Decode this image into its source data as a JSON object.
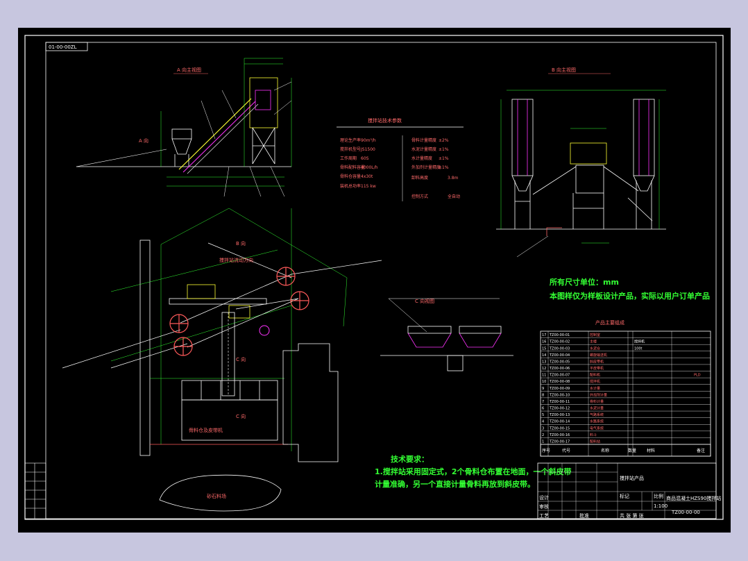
{
  "drawing": {
    "number_tag": "01-00-00ZL",
    "drawing_number": "TZ00-00-00",
    "colors": {
      "background": "#c7c6df",
      "canvas": "#000000",
      "frame": "#ffffff",
      "green": "#33ff33",
      "red": "#ff5a5a",
      "magenta": "#ff33ff",
      "yellow": "#ffff33"
    }
  },
  "views": {
    "a_view": "A 向主视图",
    "b_view": "B 向主视图",
    "c_view": "C 向视图",
    "plan_arrow": "搅拌站流动方向",
    "a_dir": "A 向",
    "b_dir": "B 向",
    "c_dir": "C 向"
  },
  "params": {
    "title": "搅拌站技术参数",
    "rows": [
      {
        "name": "理论生产率",
        "value": "90m³/h"
      },
      {
        "name": "搅拌机型号",
        "value": "JS1500"
      },
      {
        "name": "工作周期",
        "value": "60S"
      },
      {
        "name": "骨料配料容量",
        "value": "4000L/h"
      },
      {
        "name": "骨料仓容量",
        "value": "4x30t"
      },
      {
        "name": "装机总功率",
        "value": "115 kw"
      }
    ],
    "rows2": [
      {
        "name": "骨料计量精度",
        "value": "±2%"
      },
      {
        "name": "水泥计量精度",
        "value": "±1%"
      },
      {
        "name": "水计量精度",
        "value": "±1%"
      },
      {
        "name": "外加剂计量精度",
        "value": "±1%"
      },
      {
        "name": "卸料高度",
        "value": "3.8m"
      },
      {
        "name": "控制方式",
        "value": "全自动"
      }
    ]
  },
  "plan_labels": {
    "silo_area": "砂石料场",
    "storage": "骨料仓及皮带机",
    "c_label": "C 向"
  },
  "notes": {
    "unit": "所有尺寸单位：mm",
    "statement": "本图样仅为样板设计产品，实际以用户订单产品",
    "tech_title": "技术要求：",
    "tech_1": "1.搅拌站采用固定式，2个骨料仓布置在地面，一个斜皮带",
    "tech_2": "计量准确，另一个直接计量骨料再放到斜皮带。"
  },
  "parts_list": {
    "title": "产品主要组成",
    "headers": [
      "序号",
      "代号",
      "名称",
      "数量",
      "材料",
      "备注"
    ],
    "rows": [
      {
        "no": "17",
        "code": "TZ00-00-01",
        "name": "控制室"
      },
      {
        "no": "16",
        "code": "TZ00-00-02",
        "name": "主楼",
        "material": "搅拌机"
      },
      {
        "no": "15",
        "code": "TZ00-00-03",
        "name": "水泥仓",
        "material": "100t"
      },
      {
        "no": "14",
        "code": "TZ00-00-04",
        "name": "螺旋输送机"
      },
      {
        "no": "13",
        "code": "TZ00-00-05",
        "name": "斜皮带机"
      },
      {
        "no": "12",
        "code": "TZ00-00-06",
        "name": "平皮带机"
      },
      {
        "no": "11",
        "code": "TZ00-00-07",
        "name": "配料机",
        "remark": "PLD"
      },
      {
        "no": "10",
        "code": "TZ00-00-08",
        "name": "搅拌机"
      },
      {
        "no": "9",
        "code": "TZ00-00-09",
        "name": "水计量"
      },
      {
        "no": "8",
        "code": "TZ00-00-10",
        "name": "外加剂计量"
      },
      {
        "no": "7",
        "code": "TZ00-00-11",
        "name": "骨料计量"
      },
      {
        "no": "6",
        "code": "TZ00-00-12",
        "name": "水泥计量"
      },
      {
        "no": "5",
        "code": "TZ00-00-13",
        "name": "气路系统"
      },
      {
        "no": "4",
        "code": "TZ00-00-14",
        "name": "水路系统"
      },
      {
        "no": "3",
        "code": "TZ00-00-15",
        "name": "电气系统"
      },
      {
        "no": "2",
        "code": "TZ00-00-16",
        "name": "料斗"
      },
      {
        "no": "1",
        "code": "TZ00-00-17",
        "name": "配料站"
      }
    ]
  },
  "title_block": {
    "company": "搅拌站产品",
    "product": "商品混凝土HZS90搅拌站",
    "design": "设计",
    "check": "审核",
    "process": "工艺",
    "approve": "批准",
    "scale_label": "比例",
    "scale": "1:100",
    "sheet": "共 张 第 张",
    "mark": "标记"
  }
}
